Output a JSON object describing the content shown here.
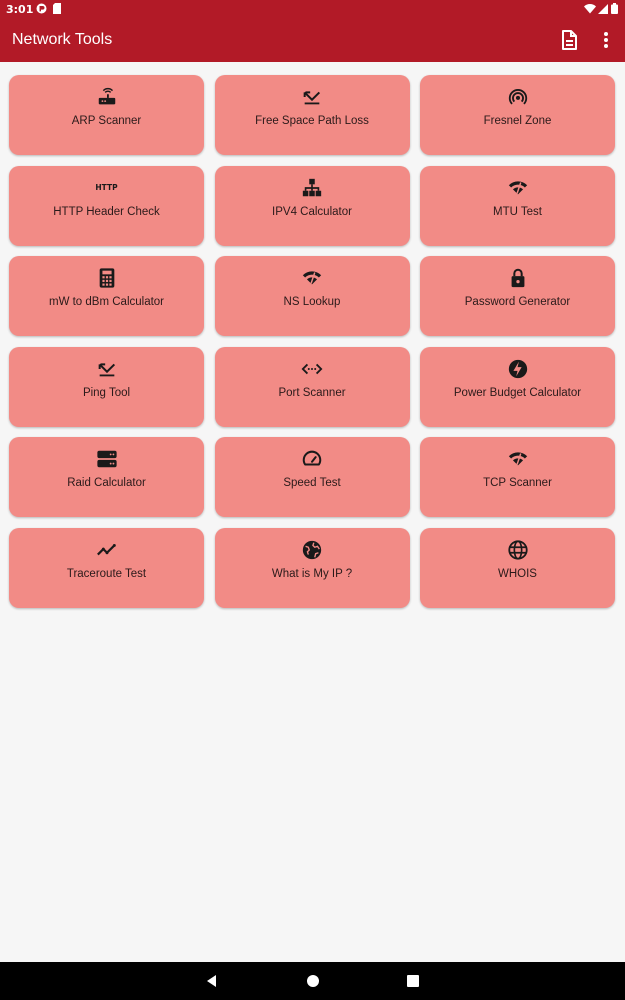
{
  "status": {
    "time": "3:01"
  },
  "appbar": {
    "title": "Network Tools",
    "actions": [
      "document-icon",
      "more-vert-icon"
    ]
  },
  "tools": [
    {
      "label": "ARP Scanner",
      "icon": "router-icon"
    },
    {
      "label": "Free Space Path Loss",
      "icon": "call-missed-icon"
    },
    {
      "label": "Fresnel Zone",
      "icon": "wifi-tethering-icon"
    },
    {
      "label": "HTTP Header Check",
      "icon": "http-icon",
      "icon_text": "HTTP"
    },
    {
      "label": "IPV4 Calculator",
      "icon": "network-tree-icon"
    },
    {
      "label": "MTU Test",
      "icon": "network-check-icon"
    },
    {
      "label": "mW to dBm Calculator",
      "icon": "calculator-icon"
    },
    {
      "label": "NS Lookup",
      "icon": "network-check-icon"
    },
    {
      "label": "Password Generator",
      "icon": "lock-icon"
    },
    {
      "label": "Ping Tool",
      "icon": "call-missed-icon"
    },
    {
      "label": "Port Scanner",
      "icon": "settings-ethernet-icon"
    },
    {
      "label": "Power Budget Calculator",
      "icon": "bolt-icon"
    },
    {
      "label": "Raid Calculator",
      "icon": "storage-icon"
    },
    {
      "label": "Speed Test",
      "icon": "speed-icon"
    },
    {
      "label": "TCP Scanner",
      "icon": "network-check-icon"
    },
    {
      "label": "Traceroute Test",
      "icon": "trending-up-icon"
    },
    {
      "label": "What is My IP ?",
      "icon": "public-globe-icon"
    },
    {
      "label": "WHOIS",
      "icon": "language-globe-icon"
    }
  ],
  "colors": {
    "appbar": "#b21a27",
    "card": "#f28b86",
    "background": "#f6f6f6"
  }
}
